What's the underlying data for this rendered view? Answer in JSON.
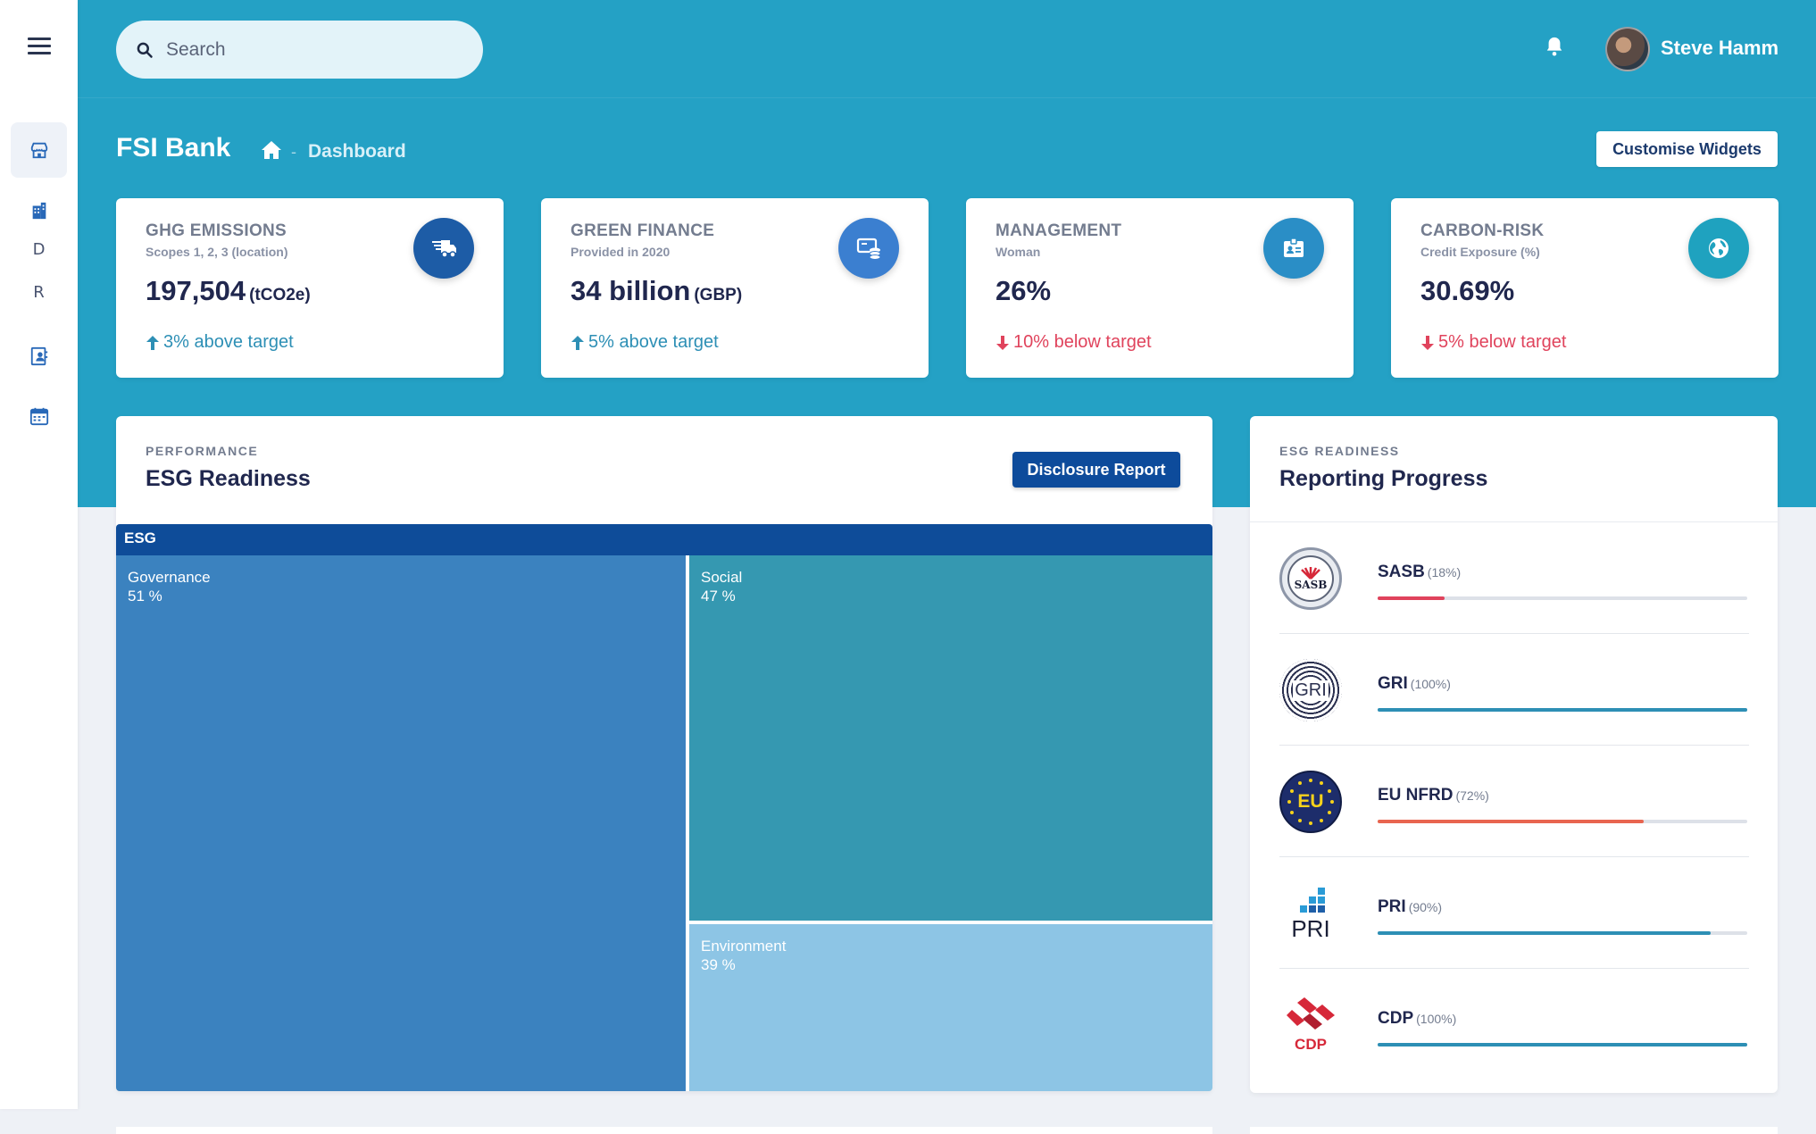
{
  "header": {
    "search_placeholder": "Search",
    "user_name": "Steve Hamm"
  },
  "sidebar": {
    "items": [
      {
        "icon": "store-icon"
      },
      {
        "icon": "building-icon"
      },
      {
        "letter": "D"
      },
      {
        "letter": "R"
      },
      {
        "icon": "contact-book-icon"
      },
      {
        "icon": "calendar-icon"
      }
    ]
  },
  "page": {
    "title": "FSI Bank",
    "breadcrumb_separator": "-",
    "breadcrumb_current": "Dashboard",
    "customise_label": "Customise Widgets"
  },
  "kpis": [
    {
      "title": "GHG EMISSIONS",
      "subtitle": "Scopes 1, 2, 3 (location)",
      "value": "197,504",
      "unit": "(tCO2e)",
      "delta": "3% above target",
      "direction": "up",
      "icon": "truck-delivery-icon",
      "icon_color": "#1d5ca6"
    },
    {
      "title": "GREEN FINANCE",
      "subtitle": "Provided in 2020",
      "value": "34 billion",
      "unit": "(GBP)",
      "delta": "5% above target",
      "direction": "up",
      "icon": "cash-stack-icon",
      "icon_color": "#3b7fd0"
    },
    {
      "title": "MANAGEMENT",
      "subtitle": "Woman",
      "value": "26%",
      "unit": "",
      "delta": "10% below target",
      "direction": "down",
      "icon": "id-card-icon",
      "icon_color": "#2a8ec6"
    },
    {
      "title": "CARBON-RISK",
      "subtitle": "Credit Exposure (%)",
      "value": "30.69%",
      "unit": "",
      "delta": "5% below target",
      "direction": "down",
      "icon": "globe-icon",
      "icon_color": "#1fa2bf"
    }
  ],
  "esg_panel": {
    "kicker": "PERFORMANCE",
    "title": "ESG Readiness",
    "button_label": "Disclosure Report"
  },
  "chart_data": {
    "type": "treemap",
    "root": "ESG",
    "nodes": [
      {
        "name": "Governance",
        "value_label": "51 %",
        "value": 51,
        "color": "#3b82bf"
      },
      {
        "name": "Social",
        "value_label": "47 %",
        "value": 47,
        "color": "#3598b1"
      },
      {
        "name": "Environment",
        "value_label": "39 %",
        "value": 39,
        "color": "#8dc5e5"
      }
    ]
  },
  "reporting": {
    "kicker": "ESG READINESS",
    "title": "Reporting Progress",
    "items": [
      {
        "name": "SASB",
        "pct_label": "(18%)",
        "progress": 0.18,
        "color": "#e0435c",
        "logo": "sasb-logo",
        "logo_text": "SASB"
      },
      {
        "name": "GRI",
        "pct_label": "(100%)",
        "progress": 1.0,
        "color": "#2d8fb5",
        "logo": "gri-logo",
        "logo_text": "GRI"
      },
      {
        "name": "EU NFRD",
        "pct_label": "(72%)",
        "progress": 0.72,
        "color": "#e8654f",
        "logo": "eu-logo",
        "logo_text": "EU"
      },
      {
        "name": "PRI",
        "pct_label": "(90%)",
        "progress": 0.9,
        "color": "#2d8fb5",
        "logo": "pri-logo",
        "logo_text": "PRI"
      },
      {
        "name": "CDP",
        "pct_label": "(100%)",
        "progress": 1.0,
        "color": "#2d8fb5",
        "logo": "cdp-logo",
        "logo_text": "CDP"
      }
    ]
  }
}
